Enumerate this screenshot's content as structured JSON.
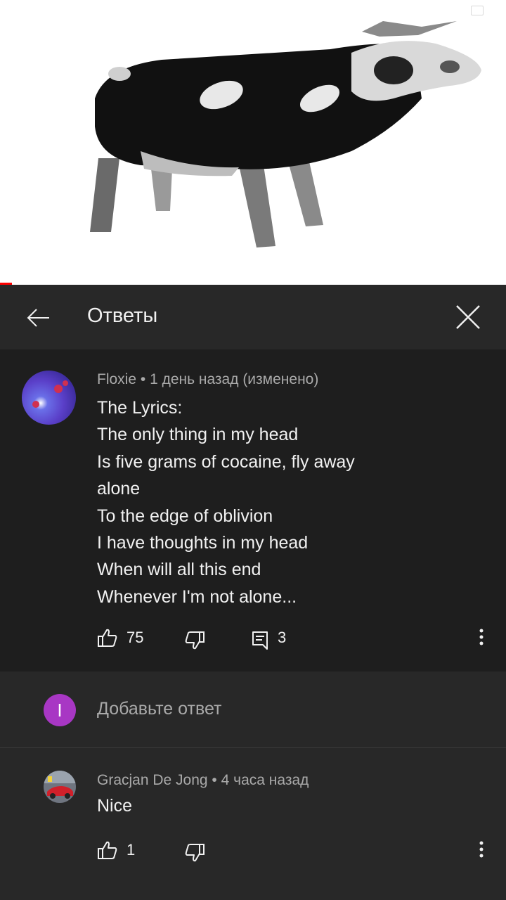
{
  "header": {
    "title": "Ответы"
  },
  "main_comment": {
    "author": "Floxie",
    "separator": " • ",
    "time": "1 день назад (изменено)",
    "lines": [
      "The Lyrics:",
      "The only thing in my head",
      "Is five grams of cocaine, fly away",
      "alone",
      "To the edge of oblivion",
      "I have thoughts in my head",
      "When will all this end",
      "Whenever I'm not alone..."
    ],
    "likes": "75",
    "replies": "3"
  },
  "reply_input": {
    "avatar_letter": "I",
    "placeholder": "Добавьте ответ"
  },
  "reply": {
    "author": "Gracjan De Jong",
    "separator": " • ",
    "time": "4 часа назад",
    "text": "Nice",
    "likes": "1"
  },
  "colors": {
    "background": "#282828",
    "comment_highlight": "#1e1e1e",
    "text_primary": "#f1f1f1",
    "text_secondary": "#aaaaaa",
    "avatar_user": "#a837c4",
    "progress": "#ff0000"
  },
  "icons": {
    "back": "arrow-left-icon",
    "close": "close-icon",
    "like": "thumb-up-icon",
    "dislike": "thumb-down-icon",
    "reply": "comment-icon",
    "more": "more-vertical-icon"
  }
}
